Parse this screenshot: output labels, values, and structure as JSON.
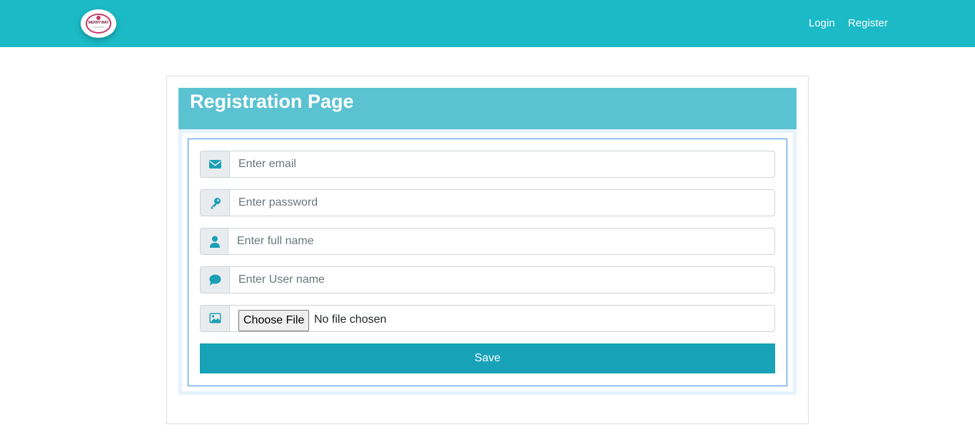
{
  "header": {
    "logo_text": "MERRYWAY",
    "logo_subtext": "FASHIONS",
    "nav": [
      {
        "label": "Login"
      },
      {
        "label": "Register"
      }
    ]
  },
  "card": {
    "title": "Registration Page"
  },
  "form": {
    "email": {
      "placeholder": "Enter email",
      "icon": "envelope-icon"
    },
    "password": {
      "placeholder": "Enter password",
      "icon": "key-icon"
    },
    "full_name": {
      "placeholder": "Enter full name",
      "icon": "user-icon"
    },
    "username": {
      "placeholder": "Enter User name",
      "icon": "comment-icon"
    },
    "file": {
      "button_label": "Choose File",
      "status": "No file chosen",
      "icon": "image-icon"
    },
    "save_label": "Save"
  },
  "colors": {
    "navbar": "#1bbac6",
    "header": "#5bc2d2",
    "button": "#17a2b8",
    "icon": "#1a9fb5"
  }
}
